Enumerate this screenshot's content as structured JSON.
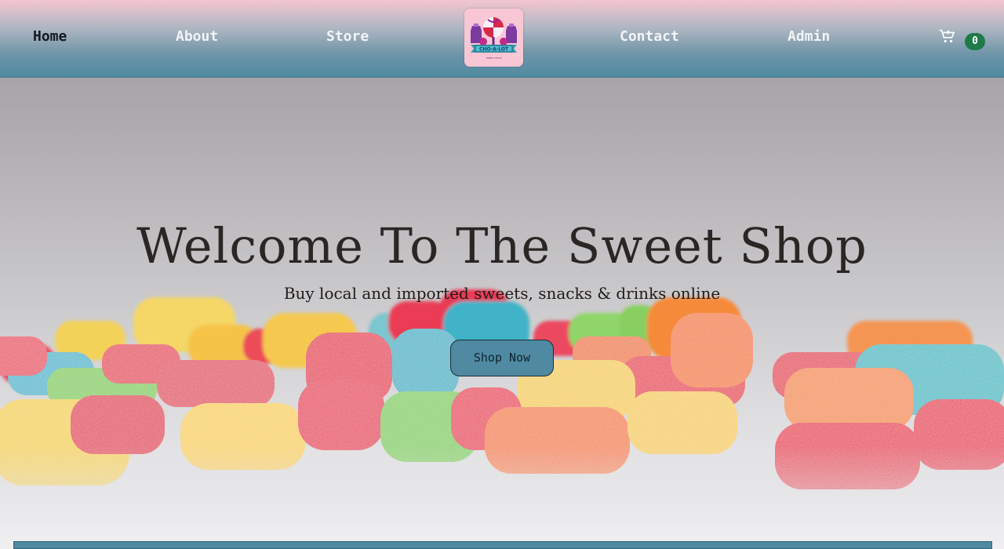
{
  "nav": {
    "links": [
      {
        "label": "Home",
        "active": true
      },
      {
        "label": "About"
      },
      {
        "label": "Store"
      },
      {
        "label": "Contact"
      },
      {
        "label": "Admin"
      }
    ],
    "logo_icon": "cho-a-lot-logo",
    "cart_icon": "cart-icon",
    "cart_count": "0"
  },
  "hero": {
    "title": "Welcome To The Sweet Shop",
    "subtitle": "Buy local and imported sweets, snacks & drinks online",
    "cta_label": "Shop Now",
    "background": "gummy-candies-photo"
  },
  "colors": {
    "accent": "#4f8aa2",
    "badge": "#1f7a4a",
    "logo_bg": "#f8c6d4"
  }
}
